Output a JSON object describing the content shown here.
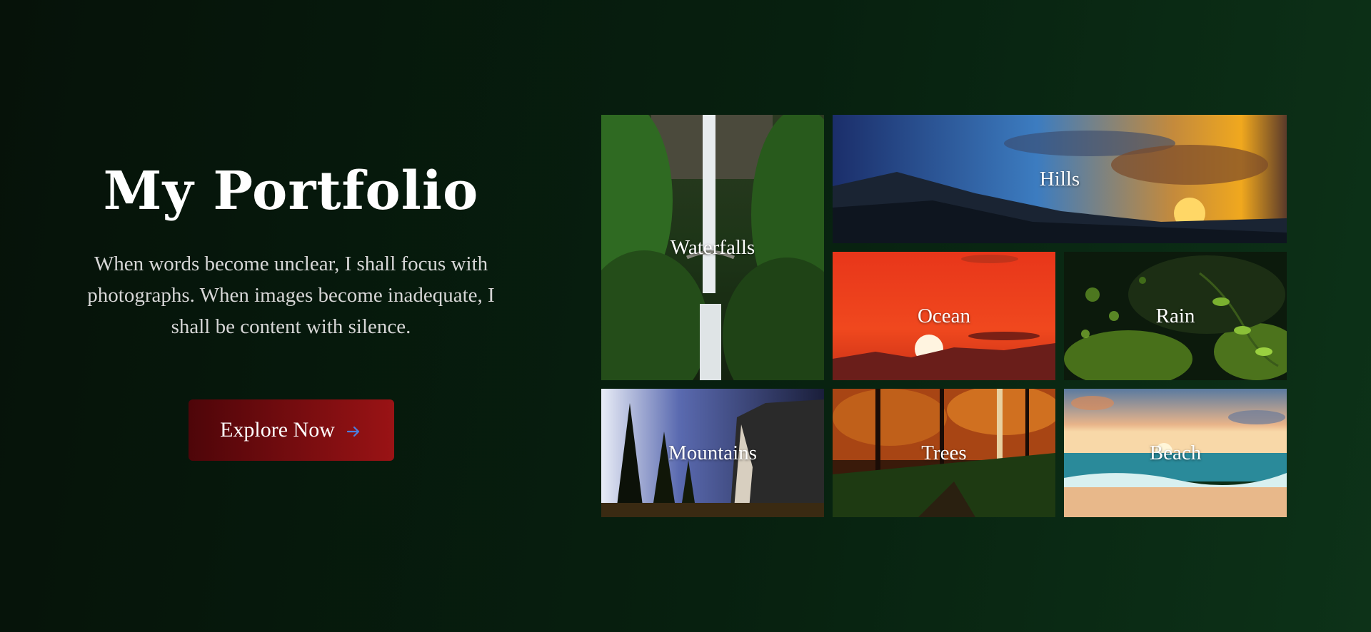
{
  "hero": {
    "title": "My Portfolio",
    "tagline": "When words become unclear, I shall focus with photographs. When images become inadequate, I shall be content with silence.",
    "cta_label": "Explore Now",
    "cta_icon": "arrow-right-icon",
    "cta_icon_color": "#4a7fe0"
  },
  "gallery": {
    "tiles": [
      {
        "label": "Waterfalls"
      },
      {
        "label": "Hills"
      },
      {
        "label": "Ocean"
      },
      {
        "label": "Rain"
      },
      {
        "label": "Mountains"
      },
      {
        "label": "Trees"
      },
      {
        "label": "Beach"
      }
    ]
  },
  "colors": {
    "background": "#07200f",
    "button_start": "#4e0509",
    "button_end": "#9a1315"
  }
}
